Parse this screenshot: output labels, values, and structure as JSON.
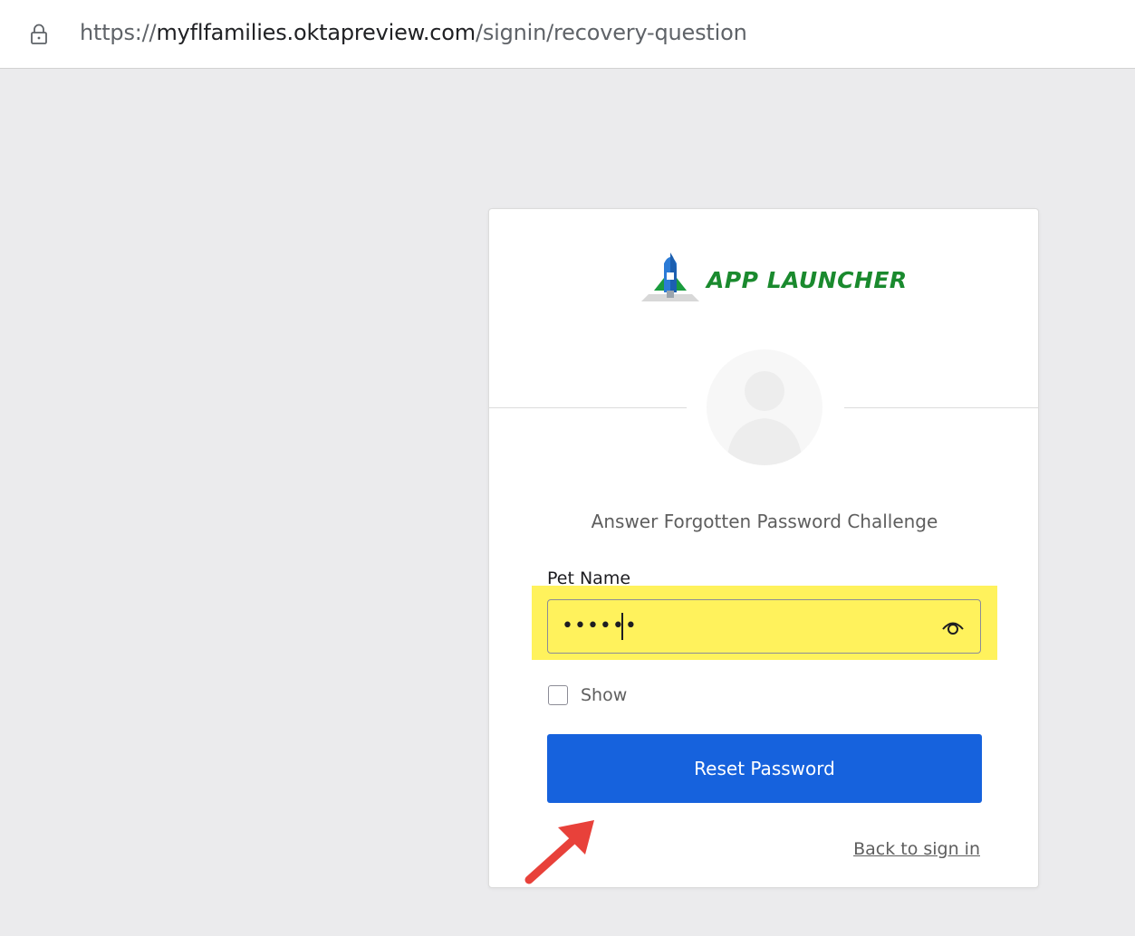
{
  "browser": {
    "url_scheme": "https://",
    "url_host": "myflfamilies.oktapreview.com",
    "url_path": "/signin/recovery-question",
    "lock_icon": "lock-icon"
  },
  "card": {
    "logo_text": "APP LAUNCHER",
    "title": "Answer Forgotten Password Challenge",
    "field_label": "Pet Name",
    "field_value": "••••••",
    "field_highlight_color": "#fff25c",
    "show_label": "Show",
    "show_checked": false,
    "reset_button": "Reset Password",
    "back_link": "Back to sign in",
    "button_color": "#1662dd"
  },
  "annotation": {
    "arrow_color": "#e8413a"
  }
}
